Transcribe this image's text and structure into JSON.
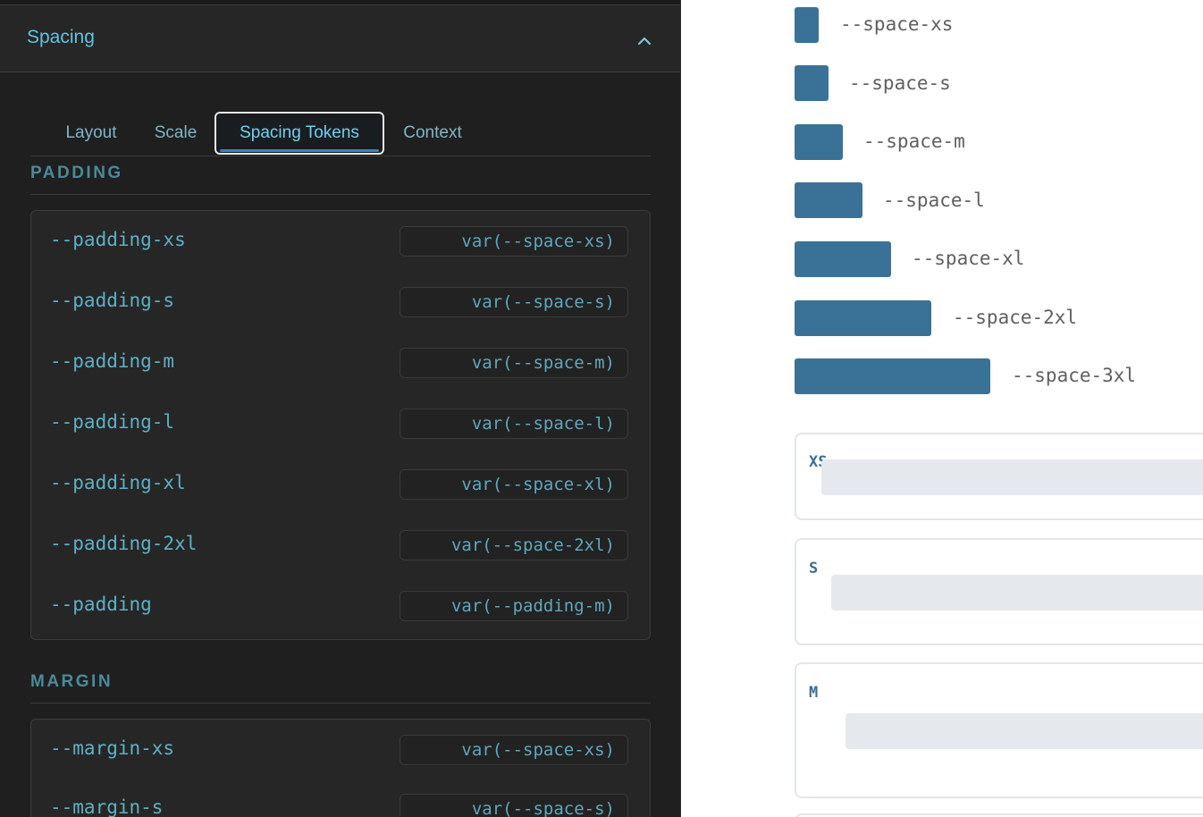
{
  "panel": {
    "title": "Spacing",
    "tabs": [
      {
        "label": "Layout",
        "active": false
      },
      {
        "label": "Scale",
        "active": false
      },
      {
        "label": "Spacing Tokens",
        "active": true
      },
      {
        "label": "Context",
        "active": false
      }
    ],
    "padding": {
      "label": "PADDING",
      "tokens": [
        {
          "name": "--padding-xs",
          "value": "var(--space-xs)"
        },
        {
          "name": "--padding-s",
          "value": "var(--space-s)"
        },
        {
          "name": "--padding-m",
          "value": "var(--space-m)"
        },
        {
          "name": "--padding-l",
          "value": "var(--space-l)"
        },
        {
          "name": "--padding-xl",
          "value": "var(--space-xl)"
        },
        {
          "name": "--padding-2xl",
          "value": "var(--space-2xl)"
        },
        {
          "name": "--padding",
          "value": "var(--padding-m)"
        }
      ]
    },
    "margin": {
      "label": "MARGIN",
      "tokens": [
        {
          "name": "--margin-xs",
          "value": "var(--space-xs)"
        },
        {
          "name": "--margin-s",
          "value": "var(--space-s)"
        }
      ]
    }
  },
  "scale": {
    "color": "#3a7197",
    "items": [
      {
        "label": "--space-xs"
      },
      {
        "label": "--space-s"
      },
      {
        "label": "--space-m"
      },
      {
        "label": "--space-l"
      },
      {
        "label": "--space-xl"
      },
      {
        "label": "--space-2xl"
      },
      {
        "label": "--space-3xl"
      }
    ]
  },
  "demos": [
    {
      "tag": "XS"
    },
    {
      "tag": "S"
    },
    {
      "tag": "M"
    }
  ]
}
